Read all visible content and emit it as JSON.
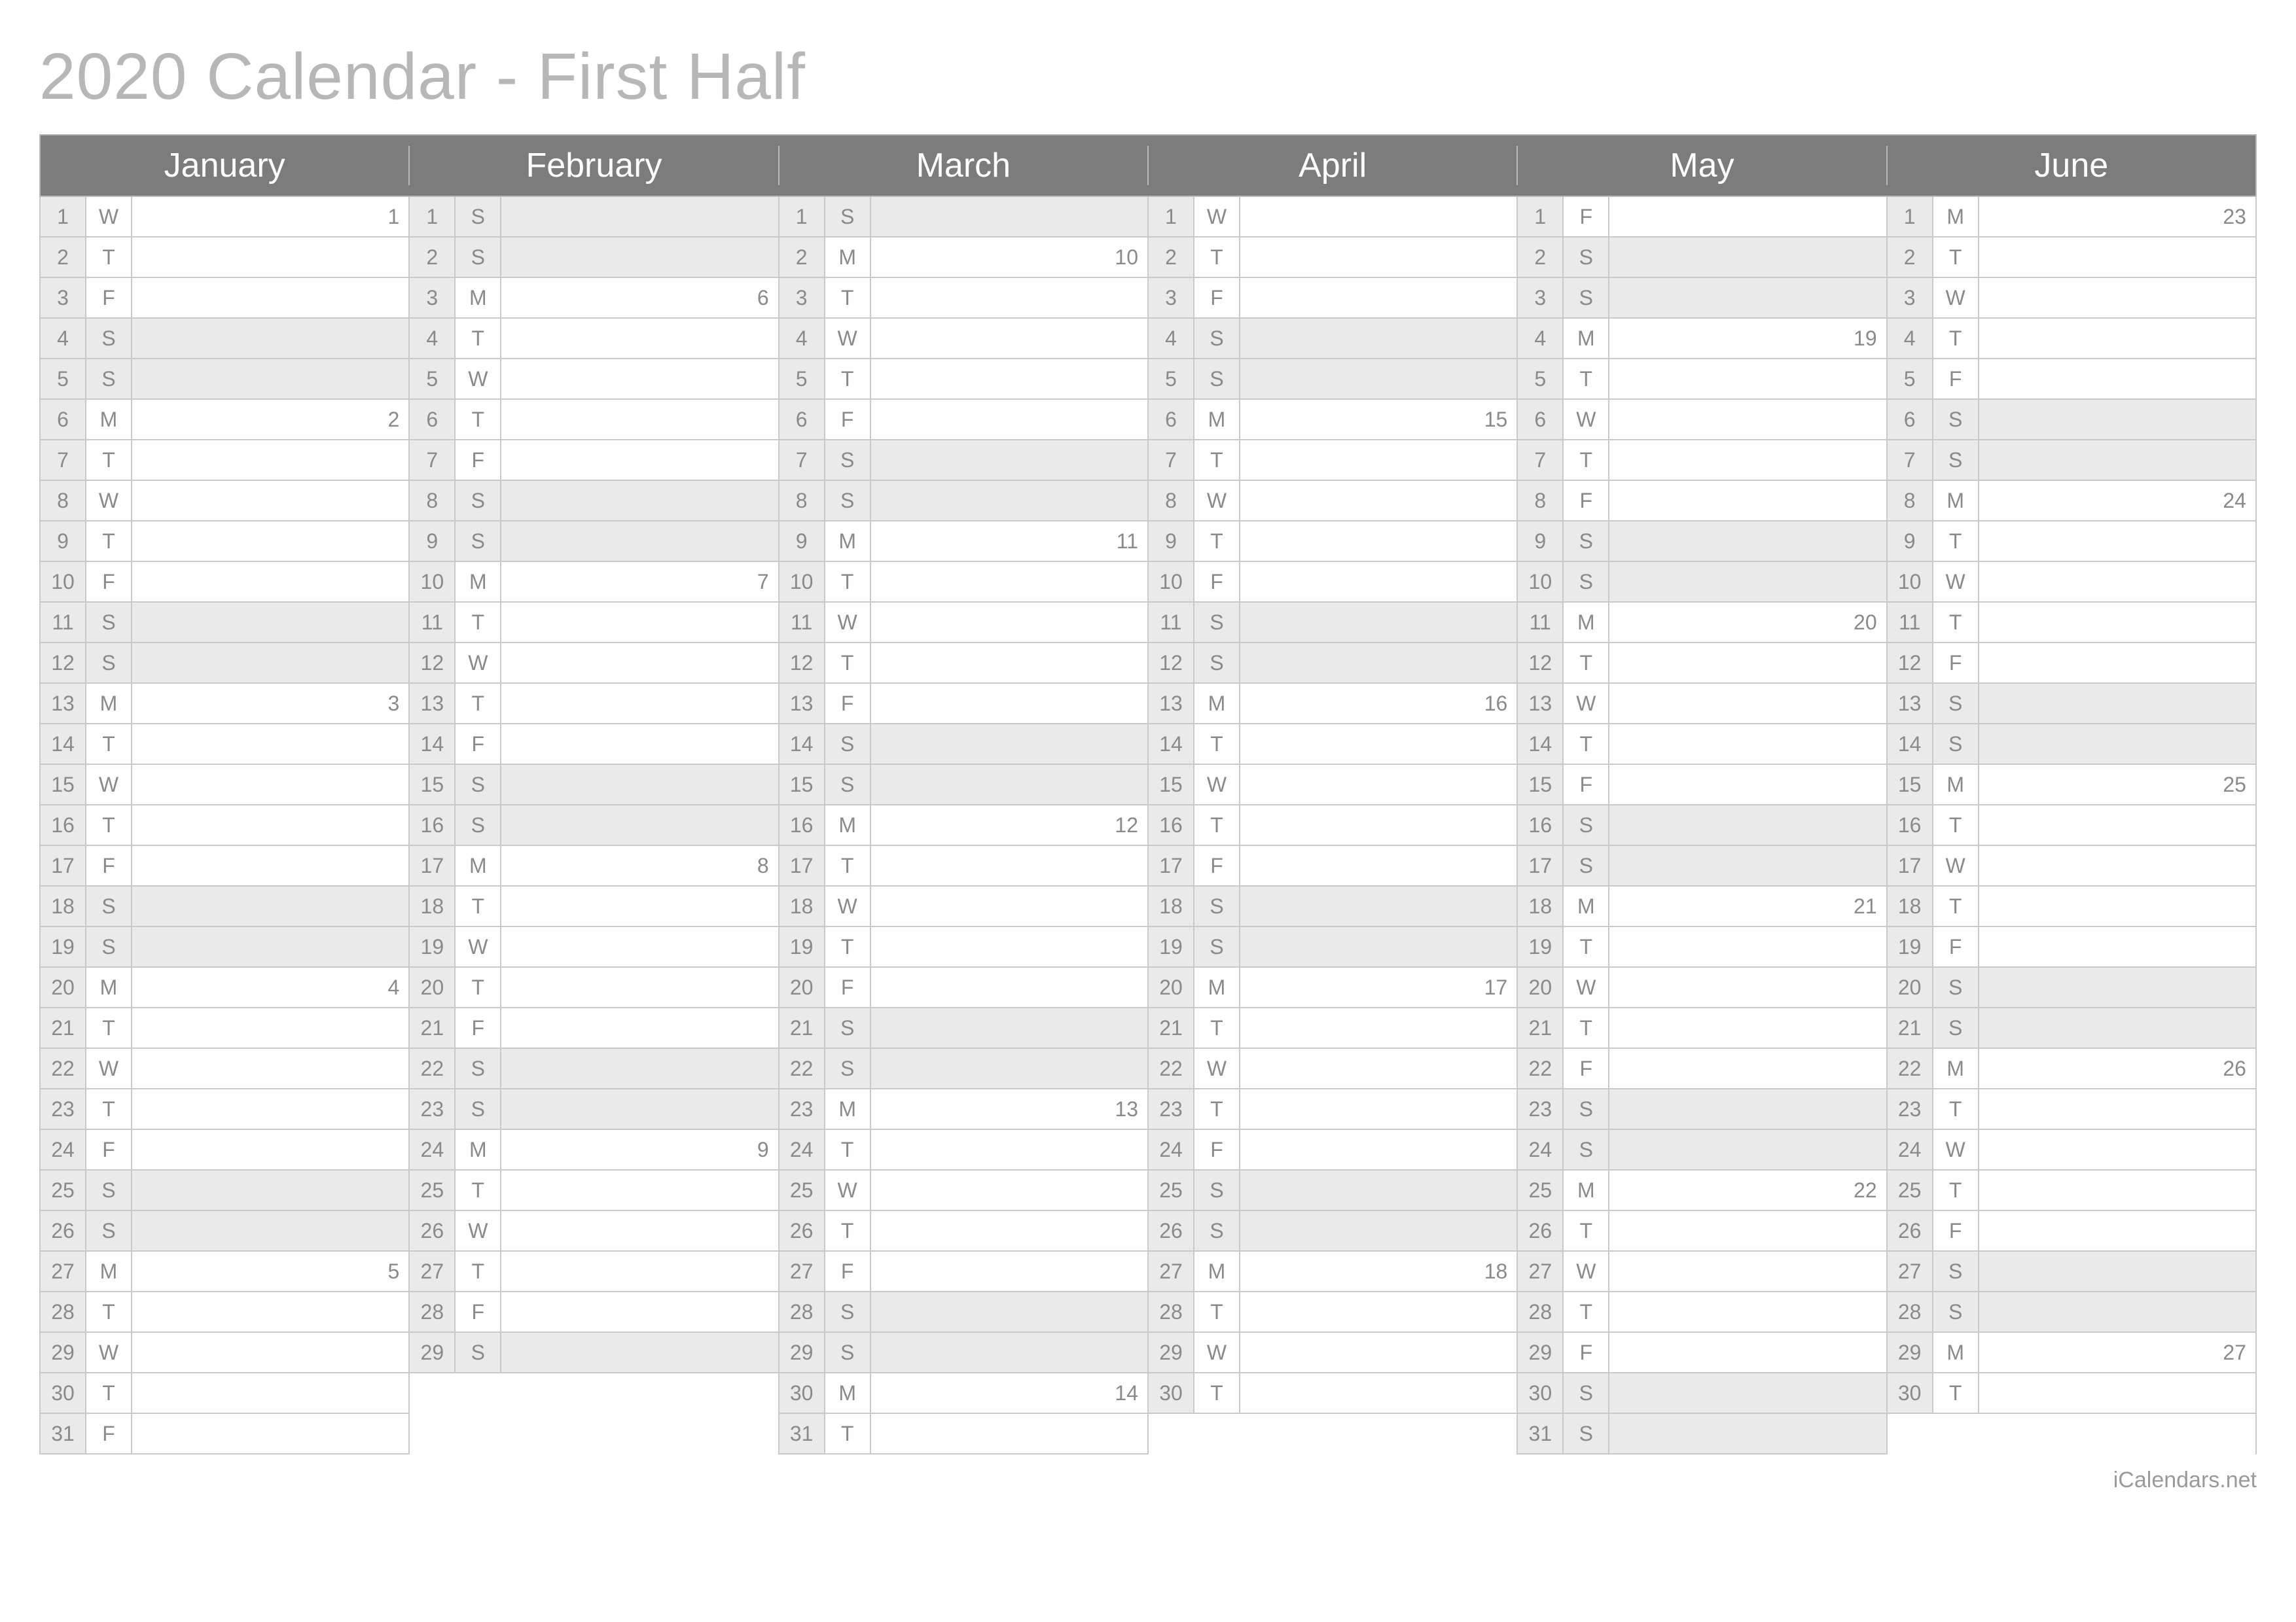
{
  "title": "2020 Calendar - First Half",
  "footer": "iCalendars.net",
  "months": [
    {
      "name": "January",
      "days": [
        {
          "n": 1,
          "dow": "W",
          "wk": "1"
        },
        {
          "n": 2,
          "dow": "T"
        },
        {
          "n": 3,
          "dow": "F"
        },
        {
          "n": 4,
          "dow": "S",
          "weekend": true
        },
        {
          "n": 5,
          "dow": "S",
          "weekend": true
        },
        {
          "n": 6,
          "dow": "M",
          "wk": "2"
        },
        {
          "n": 7,
          "dow": "T"
        },
        {
          "n": 8,
          "dow": "W"
        },
        {
          "n": 9,
          "dow": "T"
        },
        {
          "n": 10,
          "dow": "F"
        },
        {
          "n": 11,
          "dow": "S",
          "weekend": true
        },
        {
          "n": 12,
          "dow": "S",
          "weekend": true
        },
        {
          "n": 13,
          "dow": "M",
          "wk": "3"
        },
        {
          "n": 14,
          "dow": "T"
        },
        {
          "n": 15,
          "dow": "W"
        },
        {
          "n": 16,
          "dow": "T"
        },
        {
          "n": 17,
          "dow": "F"
        },
        {
          "n": 18,
          "dow": "S",
          "weekend": true
        },
        {
          "n": 19,
          "dow": "S",
          "weekend": true
        },
        {
          "n": 20,
          "dow": "M",
          "wk": "4"
        },
        {
          "n": 21,
          "dow": "T"
        },
        {
          "n": 22,
          "dow": "W"
        },
        {
          "n": 23,
          "dow": "T"
        },
        {
          "n": 24,
          "dow": "F"
        },
        {
          "n": 25,
          "dow": "S",
          "weekend": true
        },
        {
          "n": 26,
          "dow": "S",
          "weekend": true
        },
        {
          "n": 27,
          "dow": "M",
          "wk": "5"
        },
        {
          "n": 28,
          "dow": "T"
        },
        {
          "n": 29,
          "dow": "W"
        },
        {
          "n": 30,
          "dow": "T"
        },
        {
          "n": 31,
          "dow": "F"
        }
      ]
    },
    {
      "name": "February",
      "days": [
        {
          "n": 1,
          "dow": "S",
          "weekend": true
        },
        {
          "n": 2,
          "dow": "S",
          "weekend": true
        },
        {
          "n": 3,
          "dow": "M",
          "wk": "6"
        },
        {
          "n": 4,
          "dow": "T"
        },
        {
          "n": 5,
          "dow": "W"
        },
        {
          "n": 6,
          "dow": "T"
        },
        {
          "n": 7,
          "dow": "F"
        },
        {
          "n": 8,
          "dow": "S",
          "weekend": true
        },
        {
          "n": 9,
          "dow": "S",
          "weekend": true
        },
        {
          "n": 10,
          "dow": "M",
          "wk": "7"
        },
        {
          "n": 11,
          "dow": "T"
        },
        {
          "n": 12,
          "dow": "W"
        },
        {
          "n": 13,
          "dow": "T"
        },
        {
          "n": 14,
          "dow": "F"
        },
        {
          "n": 15,
          "dow": "S",
          "weekend": true
        },
        {
          "n": 16,
          "dow": "S",
          "weekend": true
        },
        {
          "n": 17,
          "dow": "M",
          "wk": "8"
        },
        {
          "n": 18,
          "dow": "T"
        },
        {
          "n": 19,
          "dow": "W"
        },
        {
          "n": 20,
          "dow": "T"
        },
        {
          "n": 21,
          "dow": "F"
        },
        {
          "n": 22,
          "dow": "S",
          "weekend": true
        },
        {
          "n": 23,
          "dow": "S",
          "weekend": true
        },
        {
          "n": 24,
          "dow": "M",
          "wk": "9"
        },
        {
          "n": 25,
          "dow": "T"
        },
        {
          "n": 26,
          "dow": "W"
        },
        {
          "n": 27,
          "dow": "T"
        },
        {
          "n": 28,
          "dow": "F"
        },
        {
          "n": 29,
          "dow": "S",
          "weekend": true
        }
      ]
    },
    {
      "name": "March",
      "days": [
        {
          "n": 1,
          "dow": "S",
          "weekend": true
        },
        {
          "n": 2,
          "dow": "M",
          "wk": "10"
        },
        {
          "n": 3,
          "dow": "T"
        },
        {
          "n": 4,
          "dow": "W"
        },
        {
          "n": 5,
          "dow": "T"
        },
        {
          "n": 6,
          "dow": "F"
        },
        {
          "n": 7,
          "dow": "S",
          "weekend": true
        },
        {
          "n": 8,
          "dow": "S",
          "weekend": true
        },
        {
          "n": 9,
          "dow": "M",
          "wk": "11"
        },
        {
          "n": 10,
          "dow": "T"
        },
        {
          "n": 11,
          "dow": "W"
        },
        {
          "n": 12,
          "dow": "T"
        },
        {
          "n": 13,
          "dow": "F"
        },
        {
          "n": 14,
          "dow": "S",
          "weekend": true
        },
        {
          "n": 15,
          "dow": "S",
          "weekend": true
        },
        {
          "n": 16,
          "dow": "M",
          "wk": "12"
        },
        {
          "n": 17,
          "dow": "T"
        },
        {
          "n": 18,
          "dow": "W"
        },
        {
          "n": 19,
          "dow": "T"
        },
        {
          "n": 20,
          "dow": "F"
        },
        {
          "n": 21,
          "dow": "S",
          "weekend": true
        },
        {
          "n": 22,
          "dow": "S",
          "weekend": true
        },
        {
          "n": 23,
          "dow": "M",
          "wk": "13"
        },
        {
          "n": 24,
          "dow": "T"
        },
        {
          "n": 25,
          "dow": "W"
        },
        {
          "n": 26,
          "dow": "T"
        },
        {
          "n": 27,
          "dow": "F"
        },
        {
          "n": 28,
          "dow": "S",
          "weekend": true
        },
        {
          "n": 29,
          "dow": "S",
          "weekend": true
        },
        {
          "n": 30,
          "dow": "M",
          "wk": "14"
        },
        {
          "n": 31,
          "dow": "T"
        }
      ]
    },
    {
      "name": "April",
      "days": [
        {
          "n": 1,
          "dow": "W"
        },
        {
          "n": 2,
          "dow": "T"
        },
        {
          "n": 3,
          "dow": "F"
        },
        {
          "n": 4,
          "dow": "S",
          "weekend": true
        },
        {
          "n": 5,
          "dow": "S",
          "weekend": true
        },
        {
          "n": 6,
          "dow": "M",
          "wk": "15"
        },
        {
          "n": 7,
          "dow": "T"
        },
        {
          "n": 8,
          "dow": "W"
        },
        {
          "n": 9,
          "dow": "T"
        },
        {
          "n": 10,
          "dow": "F"
        },
        {
          "n": 11,
          "dow": "S",
          "weekend": true
        },
        {
          "n": 12,
          "dow": "S",
          "weekend": true
        },
        {
          "n": 13,
          "dow": "M",
          "wk": "16"
        },
        {
          "n": 14,
          "dow": "T"
        },
        {
          "n": 15,
          "dow": "W"
        },
        {
          "n": 16,
          "dow": "T"
        },
        {
          "n": 17,
          "dow": "F"
        },
        {
          "n": 18,
          "dow": "S",
          "weekend": true
        },
        {
          "n": 19,
          "dow": "S",
          "weekend": true
        },
        {
          "n": 20,
          "dow": "M",
          "wk": "17"
        },
        {
          "n": 21,
          "dow": "T"
        },
        {
          "n": 22,
          "dow": "W"
        },
        {
          "n": 23,
          "dow": "T"
        },
        {
          "n": 24,
          "dow": "F"
        },
        {
          "n": 25,
          "dow": "S",
          "weekend": true
        },
        {
          "n": 26,
          "dow": "S",
          "weekend": true
        },
        {
          "n": 27,
          "dow": "M",
          "wk": "18"
        },
        {
          "n": 28,
          "dow": "T"
        },
        {
          "n": 29,
          "dow": "W"
        },
        {
          "n": 30,
          "dow": "T"
        }
      ]
    },
    {
      "name": "May",
      "days": [
        {
          "n": 1,
          "dow": "F"
        },
        {
          "n": 2,
          "dow": "S",
          "weekend": true
        },
        {
          "n": 3,
          "dow": "S",
          "weekend": true
        },
        {
          "n": 4,
          "dow": "M",
          "wk": "19"
        },
        {
          "n": 5,
          "dow": "T"
        },
        {
          "n": 6,
          "dow": "W"
        },
        {
          "n": 7,
          "dow": "T"
        },
        {
          "n": 8,
          "dow": "F"
        },
        {
          "n": 9,
          "dow": "S",
          "weekend": true
        },
        {
          "n": 10,
          "dow": "S",
          "weekend": true
        },
        {
          "n": 11,
          "dow": "M",
          "wk": "20"
        },
        {
          "n": 12,
          "dow": "T"
        },
        {
          "n": 13,
          "dow": "W"
        },
        {
          "n": 14,
          "dow": "T"
        },
        {
          "n": 15,
          "dow": "F"
        },
        {
          "n": 16,
          "dow": "S",
          "weekend": true
        },
        {
          "n": 17,
          "dow": "S",
          "weekend": true
        },
        {
          "n": 18,
          "dow": "M",
          "wk": "21"
        },
        {
          "n": 19,
          "dow": "T"
        },
        {
          "n": 20,
          "dow": "W"
        },
        {
          "n": 21,
          "dow": "T"
        },
        {
          "n": 22,
          "dow": "F"
        },
        {
          "n": 23,
          "dow": "S",
          "weekend": true
        },
        {
          "n": 24,
          "dow": "S",
          "weekend": true
        },
        {
          "n": 25,
          "dow": "M",
          "wk": "22"
        },
        {
          "n": 26,
          "dow": "T"
        },
        {
          "n": 27,
          "dow": "W"
        },
        {
          "n": 28,
          "dow": "T"
        },
        {
          "n": 29,
          "dow": "F"
        },
        {
          "n": 30,
          "dow": "S",
          "weekend": true
        },
        {
          "n": 31,
          "dow": "S",
          "weekend": true
        }
      ]
    },
    {
      "name": "June",
      "days": [
        {
          "n": 1,
          "dow": "M",
          "wk": "23"
        },
        {
          "n": 2,
          "dow": "T"
        },
        {
          "n": 3,
          "dow": "W"
        },
        {
          "n": 4,
          "dow": "T"
        },
        {
          "n": 5,
          "dow": "F"
        },
        {
          "n": 6,
          "dow": "S",
          "weekend": true
        },
        {
          "n": 7,
          "dow": "S",
          "weekend": true
        },
        {
          "n": 8,
          "dow": "M",
          "wk": "24"
        },
        {
          "n": 9,
          "dow": "T"
        },
        {
          "n": 10,
          "dow": "W"
        },
        {
          "n": 11,
          "dow": "T"
        },
        {
          "n": 12,
          "dow": "F"
        },
        {
          "n": 13,
          "dow": "S",
          "weekend": true
        },
        {
          "n": 14,
          "dow": "S",
          "weekend": true
        },
        {
          "n": 15,
          "dow": "M",
          "wk": "25"
        },
        {
          "n": 16,
          "dow": "T"
        },
        {
          "n": 17,
          "dow": "W"
        },
        {
          "n": 18,
          "dow": "T"
        },
        {
          "n": 19,
          "dow": "F"
        },
        {
          "n": 20,
          "dow": "S",
          "weekend": true
        },
        {
          "n": 21,
          "dow": "S",
          "weekend": true
        },
        {
          "n": 22,
          "dow": "M",
          "wk": "26"
        },
        {
          "n": 23,
          "dow": "T"
        },
        {
          "n": 24,
          "dow": "W"
        },
        {
          "n": 25,
          "dow": "T"
        },
        {
          "n": 26,
          "dow": "F"
        },
        {
          "n": 27,
          "dow": "S",
          "weekend": true
        },
        {
          "n": 28,
          "dow": "S",
          "weekend": true
        },
        {
          "n": 29,
          "dow": "M",
          "wk": "27"
        },
        {
          "n": 30,
          "dow": "T"
        }
      ]
    }
  ]
}
